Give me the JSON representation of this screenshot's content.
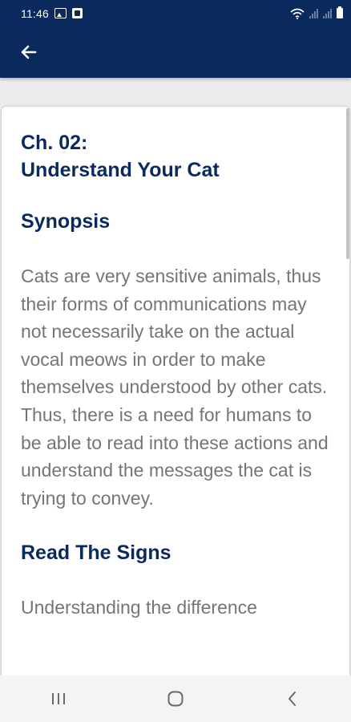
{
  "status_bar": {
    "time": "11:46"
  },
  "app_bar": {
    "back_icon": "arrow-left-icon"
  },
  "content": {
    "chapter": "Ch. 02:",
    "chapter_title": "Understand Your Cat",
    "synopsis_heading": "Synopsis",
    "synopsis_text": "Cats are very sensitive animals, thus their forms of communications may not necessarily take on the actual vocal meows in order to make themselves understood by other cats. Thus, there is a need for humans to be able to read into these actions and understand the messages the cat is trying to convey.",
    "signs_heading": "Read The Signs",
    "signs_text": "Understanding the difference"
  },
  "nav_bar": {
    "recents_icon": "recents-icon",
    "home_icon": "home-icon",
    "back_icon": "back-chevron-icon"
  },
  "colors": {
    "primary": "#0a2a5e",
    "body_text": "#757575"
  }
}
